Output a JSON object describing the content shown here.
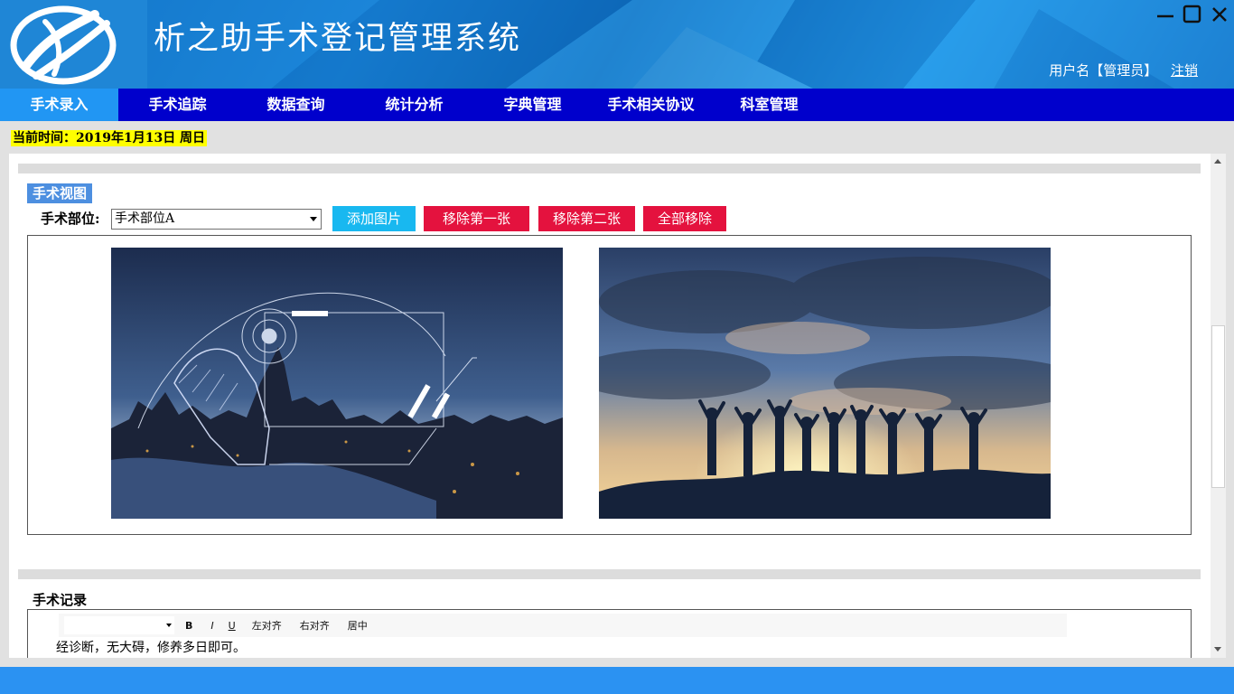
{
  "app": {
    "title": "析之助手术登记管理系统",
    "user_label": "用户名【管理员】",
    "logout_label": "注销"
  },
  "nav": {
    "items": [
      {
        "label": "手术录入",
        "active": true
      },
      {
        "label": "手术追踪"
      },
      {
        "label": "数据查询"
      },
      {
        "label": "统计分析"
      },
      {
        "label": "字典管理"
      },
      {
        "label": "手术相关协议"
      },
      {
        "label": "科室管理"
      }
    ]
  },
  "status": {
    "current_time": "当前时间：2019年1月13日  周日"
  },
  "surgery_view": {
    "section_title": "手术视图",
    "site_label": "手术部位:",
    "site_value": "手术部位A",
    "buttons": {
      "add_image": "添加图片",
      "remove_first": "移除第一张",
      "remove_second": "移除第二张",
      "remove_all": "全部移除"
    },
    "images": [
      {
        "icon": "city-tech-hand-image"
      },
      {
        "icon": "sunset-silhouettes-image"
      }
    ]
  },
  "surgery_record": {
    "section_title": "手术记录",
    "toolbar": {
      "bold": "B",
      "italic": "I",
      "underline": "U",
      "align_left": "左对齐",
      "align_right": "右对齐",
      "center": "居中"
    },
    "content": "经诊断，无大碍，修养多日即可。"
  },
  "colors": {
    "nav_bg": "#0000cc",
    "nav_active": "#2196f3",
    "btn_cyan": "#18b8f0",
    "btn_red": "#e4123e",
    "time_highlight": "#ffff00",
    "section_tag": "#4d8fe0",
    "footer": "#2b92f2"
  }
}
